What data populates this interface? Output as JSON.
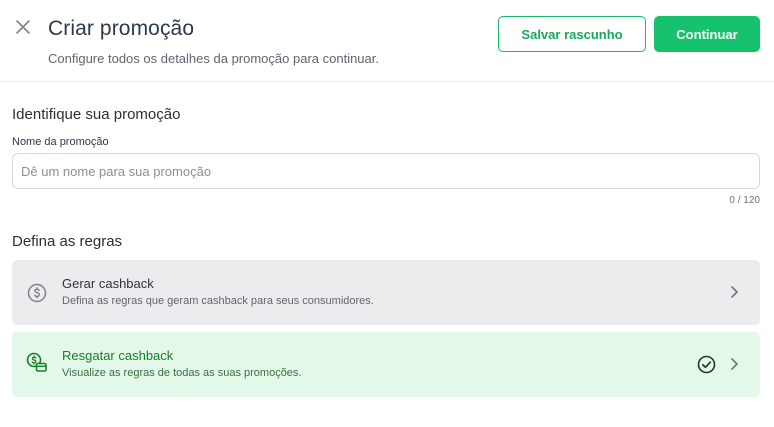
{
  "header": {
    "title": "Criar promoção",
    "subtitle": "Configure todos os detalhes da promoção para continuar.",
    "save_draft_label": "Salvar rascunho",
    "continue_label": "Continuar"
  },
  "identify": {
    "section_title": "Identifique sua promoção",
    "field_label": "Nome da promoção",
    "placeholder": "Dê um nome para sua promoção",
    "value": "",
    "counter": "0 / 120"
  },
  "rules": {
    "section_title": "Defina as regras",
    "items": [
      {
        "icon": "dollar-circle-icon",
        "title": "Gerar cashback",
        "description": "Defina as regras que geram cashback para seus consumidores.",
        "completed": false
      },
      {
        "icon": "redeem-cashback-icon",
        "title": "Resgatar cashback",
        "description": "Visualize as regras de todas as suas promoções.",
        "completed": true
      }
    ]
  },
  "colors": {
    "primary": "#17c26e",
    "completed_bg": "#e3f8e8",
    "completed_text": "#1a7f28",
    "card_bg": "#ececee"
  }
}
